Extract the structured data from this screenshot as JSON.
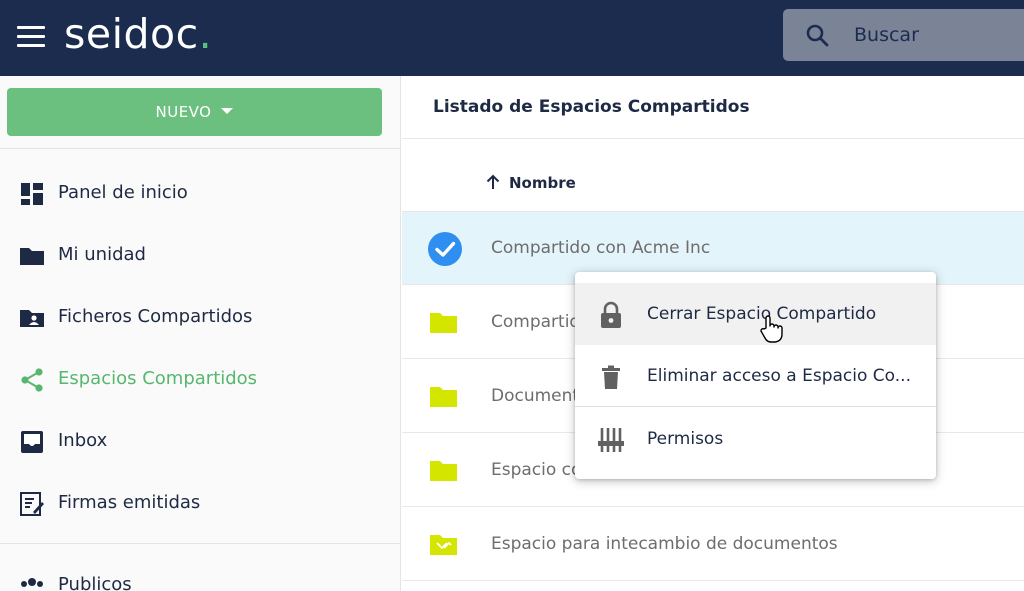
{
  "header": {
    "logo_text": "seidoc",
    "logo_dot": ".",
    "search_placeholder": "Buscar",
    "icons": {
      "menu": "hamburger-icon",
      "search": "search-icon"
    }
  },
  "sidebar": {
    "new_button_label": "NUEVO",
    "items": [
      {
        "label": "Panel de inicio",
        "icon": "dashboard-icon",
        "active": false
      },
      {
        "label": "Mi unidad",
        "icon": "folder-icon",
        "active": false
      },
      {
        "label": "Ficheros Compartidos",
        "icon": "shared-folder-icon",
        "active": false
      },
      {
        "label": "Espacios Compartidos",
        "icon": "share-icon",
        "active": true
      },
      {
        "label": "Inbox",
        "icon": "inbox-icon",
        "active": false
      },
      {
        "label": "Firmas emitidas",
        "icon": "signature-icon",
        "active": false
      },
      {
        "label": "Publicos",
        "icon": "groups-icon",
        "active": false
      }
    ]
  },
  "main": {
    "title": "Listado de Espacios Compartidos",
    "column_header": "Nombre",
    "rows": [
      {
        "label": "Compartido con Acme Inc",
        "icon": "check-circle-icon",
        "selected": true
      },
      {
        "label": "Compartido",
        "icon": "folder-icon",
        "selected": false
      },
      {
        "label": "Document",
        "icon": "folder-icon",
        "selected": false
      },
      {
        "label": "Espacio co",
        "icon": "folder-icon",
        "selected": false
      },
      {
        "label": "Espacio para intecambio de documentos",
        "icon": "exchange-folder-icon",
        "selected": false
      }
    ]
  },
  "context_menu": {
    "items": [
      {
        "label": "Cerrar Espacio Compartido",
        "icon": "lock-icon",
        "hover": true
      },
      {
        "label": "Eliminar acceso a Espacio Co...",
        "icon": "trash-icon",
        "hover": false
      },
      {
        "label": "Permisos",
        "icon": "sliders-icon",
        "hover": false
      }
    ]
  },
  "colors": {
    "topbar": "#1b2c4f",
    "accent_green": "#6cc07f",
    "active_green": "#57b66f",
    "folder_yellow": "#d4e600",
    "check_blue": "#2f8ff0",
    "selected_row": "#e3f4fa"
  }
}
